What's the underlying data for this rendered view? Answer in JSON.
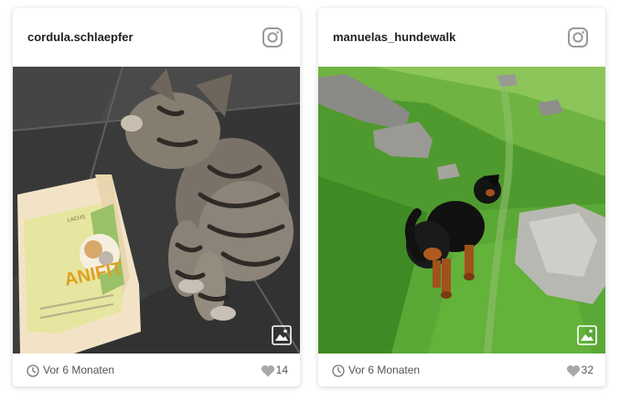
{
  "colors": {
    "text": "#222222",
    "muted": "#555555",
    "icon_gray": "#9a9a9a",
    "card_bg": "#ffffff"
  },
  "posts": [
    {
      "username": "cordula.schlaepfer",
      "date": "Vor 6 Monaten",
      "likes": "14",
      "photo_subject": "kitten-with-food-bag",
      "package_text": {
        "top": "LACHS",
        "brand": "ANIFIT"
      }
    },
    {
      "username": "manuelas_hundewalk",
      "date": "Vor 6 Monaten",
      "likes": "32",
      "photo_subject": "dog-on-mountain-meadow"
    }
  ],
  "icons": [
    "instagram-icon",
    "image-icon",
    "clock-icon",
    "heart-icon"
  ]
}
